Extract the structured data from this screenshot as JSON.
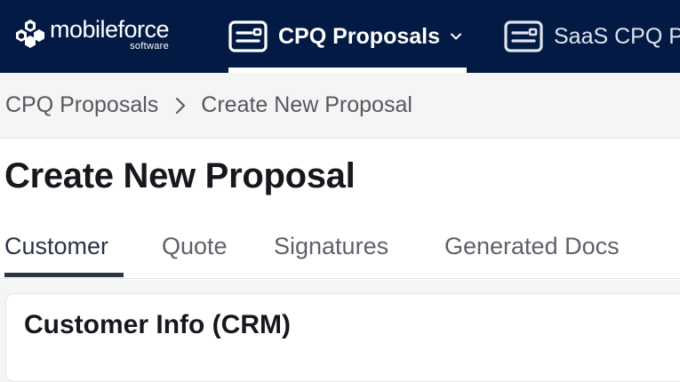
{
  "brand": {
    "name": "mobileforce",
    "tagline": "software"
  },
  "top_nav": {
    "tabs": [
      {
        "label": "CPQ Proposals",
        "icon": "id-card-icon",
        "active": true,
        "has_dropdown": true
      },
      {
        "label": "SaaS CPQ P",
        "icon": "id-card-icon",
        "active": false
      }
    ]
  },
  "breadcrumb": {
    "items": [
      "CPQ Proposals",
      "Create New Proposal"
    ],
    "separator_icon": "chevron-right-icon"
  },
  "page": {
    "title": "Create New Proposal"
  },
  "section_tabs": {
    "items": [
      "Customer",
      "Quote",
      "Signatures",
      "Generated Docs"
    ],
    "active": "Customer"
  },
  "card": {
    "title": "Customer Info (CRM)"
  },
  "colors": {
    "nav_background": "#031a44",
    "breadcrumb_background": "#f5f5f6",
    "active_tab_underline": "#2e3547",
    "title_text": "#16181d"
  }
}
